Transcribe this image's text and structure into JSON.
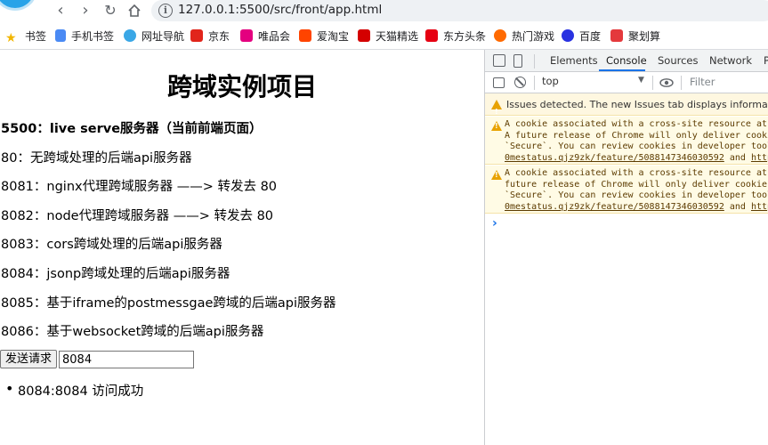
{
  "browser": {
    "url": "127.0.0.1:5500/src/front/app.html",
    "bookmarks": [
      {
        "label": "书签",
        "icon": "star-icon",
        "color": "#f2b600"
      },
      {
        "label": "手机书签",
        "icon": "phone-bookmark-icon",
        "color": "#4a8af4"
      },
      {
        "label": "网址导航",
        "icon": "navigation-icon",
        "color": "#3aa7e6"
      },
      {
        "label": "京东",
        "icon": "jd-icon",
        "color": "#e1251b"
      },
      {
        "label": "唯品会",
        "icon": "vip-icon",
        "color": "#e4007f"
      },
      {
        "label": "爱淘宝",
        "icon": "taobao-icon",
        "color": "#ff4400"
      },
      {
        "label": "天猫精选",
        "icon": "tmall-icon",
        "color": "#d40000"
      },
      {
        "label": "东方头条",
        "icon": "dftt-icon",
        "color": "#e60012"
      },
      {
        "label": "热门游戏",
        "icon": "game-icon",
        "color": "#ff6a00"
      },
      {
        "label": "百度",
        "icon": "baidu-icon",
        "color": "#2932e1"
      },
      {
        "label": "聚划算",
        "icon": "juhuasuan-icon",
        "color": "#e4393c"
      }
    ]
  },
  "page": {
    "title": "跨域实例项目",
    "lines": [
      "5500：live serve服务器（当前前端页面）",
      "80：无跨域处理的后端api服务器",
      "8081：nginx代理跨域服务器 ——> 转发去 80",
      "8082：node代理跨域服务器 ——> 转发去 80",
      "8083：cors跨域处理的后端api服务器",
      "8084：jsonp跨域处理的后端api服务器",
      "8085：基于iframe的postmessgae跨域的后端api服务器",
      "8086：基于websocket跨域的后端api服务器"
    ],
    "send_button": "发送请求",
    "port_input_value": "8084",
    "result_item": "8084:8084 访问成功"
  },
  "devtools": {
    "tabs": [
      "Elements",
      "Console",
      "Sources",
      "Network",
      "P"
    ],
    "active_tab": "Console",
    "context": "top",
    "filter_placeholder": "Filter",
    "issues_banner": "Issues detected. The new Issues tab displays information about",
    "messages": [
      {
        "line1": "A cookie associated with a cross-site resource at h",
        "line2": "A future release of Chrome will only deliver cookie",
        "line3": "`Secure`. You can review cookies in developer tools",
        "link": "0mestatus.qjz9zk/feature/5088147346030592",
        "tail": " and ",
        "link2": "https"
      },
      {
        "line1": "A cookie associated with a cross-site resource at h",
        "line2": "future release of Chrome will only deliver cookies",
        "line3": "`Secure`. You can review cookies in developer tools",
        "link": "0mestatus.qjz9zk/feature/5088147346030592",
        "tail": " and ",
        "link2": "https"
      }
    ],
    "prompt": "›",
    "accent": "#1a73e8",
    "warning_color": "#e8a200"
  }
}
